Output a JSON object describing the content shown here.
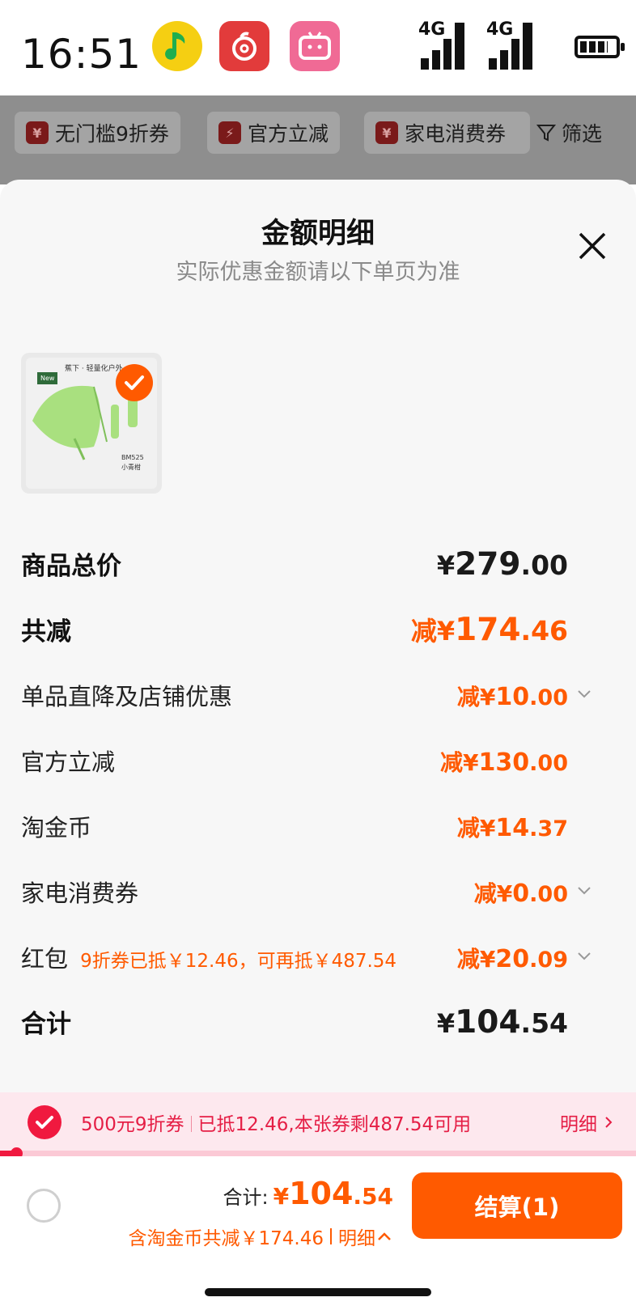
{
  "status_bar": {
    "time": "16:51",
    "network_1": "4G",
    "network_2": "4G",
    "icons": [
      "qq-music-icon",
      "netease-music-icon",
      "bilibili-icon",
      "signal-icon",
      "battery-icon"
    ]
  },
  "filters": {
    "chips": [
      {
        "label": "无门槛9折券",
        "icon": "yuan-coupon-icon"
      },
      {
        "label": "官方立减",
        "icon": "lightning-icon"
      },
      {
        "label": "家电消费券",
        "icon": "yuan-coupon-icon"
      }
    ],
    "filter_label": "筛选",
    "filter_icon": "funnel-icon"
  },
  "sheet": {
    "title": "金额明细",
    "subtitle": "实际优惠金额请以下单页为准",
    "product": {
      "brand_line": "蕉下 · 轻量化户外",
      "badge": "New",
      "model": "BM525",
      "model_name": "小青柑",
      "selected": true
    },
    "rows": [
      {
        "label": "商品总价",
        "prefix": "",
        "currency": "¥",
        "int": "279",
        "dec": ".00"
      },
      {
        "label": "共减",
        "prefix": "减",
        "currency": "¥",
        "int": "174",
        "dec": ".46"
      },
      {
        "label": "单品直降及店铺优惠",
        "prefix": "减",
        "currency": "¥",
        "int": "10",
        "dec": ".00"
      },
      {
        "label": "官方立减",
        "prefix": "减",
        "currency": "¥",
        "int": "130",
        "dec": ".00"
      },
      {
        "label": "淘金币",
        "prefix": "减",
        "currency": "¥",
        "int": "14",
        "dec": ".37"
      },
      {
        "label": "家电消费券",
        "prefix": "减",
        "currency": "¥",
        "int": "0",
        "dec": ".00"
      },
      {
        "label": "红包",
        "note": "9折券已抵￥12.46，可再抵￥487.54",
        "prefix": "减",
        "currency": "¥",
        "int": "20",
        "dec": ".09"
      },
      {
        "label": "合计",
        "prefix": "",
        "currency": "¥",
        "int": "104",
        "dec": ".54"
      }
    ]
  },
  "coupon": {
    "name": "500元9折券",
    "detail_text": "已抵12.46,本张券剩487.54可用",
    "detail_link": "明细",
    "used_fraction": 0.025
  },
  "bottom": {
    "total_label": "合计:",
    "total_currency": "¥",
    "total_int": "104",
    "total_dec": ".54",
    "saved_text": "含淘金币共减￥174.46",
    "saved_link": "明细",
    "checkout_label": "结算(1)"
  },
  "colors": {
    "accent_orange": "#ff5a00",
    "coupon_red": "#f0193f",
    "coupon_bg": "#fde8ee"
  }
}
